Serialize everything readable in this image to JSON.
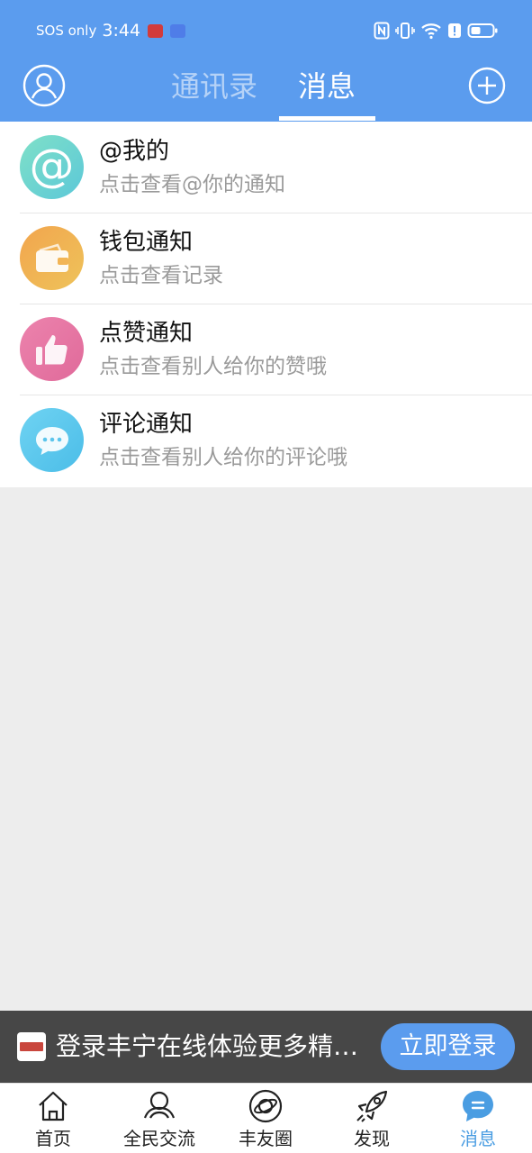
{
  "status_bar": {
    "carrier": "SOS only",
    "time": "3:44",
    "colors": {
      "app1": "#d23b3b",
      "app2": "#4f7de8"
    }
  },
  "header": {
    "tabs": [
      {
        "label": "通讯录",
        "active": false
      },
      {
        "label": "消息",
        "active": true
      }
    ],
    "bg_color": "#5b9cee"
  },
  "notices": [
    {
      "title": "@我的",
      "subtitle": "点击查看@你的通知",
      "icon": "at-icon"
    },
    {
      "title": "钱包通知",
      "subtitle": "点击查看记录",
      "icon": "wallet-icon"
    },
    {
      "title": "点赞通知",
      "subtitle": "点击查看别人给你的赞哦",
      "icon": "thumbs-up-icon"
    },
    {
      "title": "评论通知",
      "subtitle": "点击查看别人给你的评论哦",
      "icon": "chat-bubble-icon"
    }
  ],
  "banner": {
    "text": "登录丰宁在线体验更多精彩内容",
    "button_label": "立即登录"
  },
  "bottom_nav": [
    {
      "label": "首页",
      "icon": "home-icon",
      "active": false
    },
    {
      "label": "全民交流",
      "icon": "people-icon",
      "active": false
    },
    {
      "label": "丰友圈",
      "icon": "planet-icon",
      "active": false
    },
    {
      "label": "发现",
      "icon": "rocket-icon",
      "active": false
    },
    {
      "label": "消息",
      "icon": "message-bubble-icon",
      "active": true
    }
  ],
  "colors": {
    "accent": "#5b9cee",
    "nav_active": "#4a9de2"
  }
}
